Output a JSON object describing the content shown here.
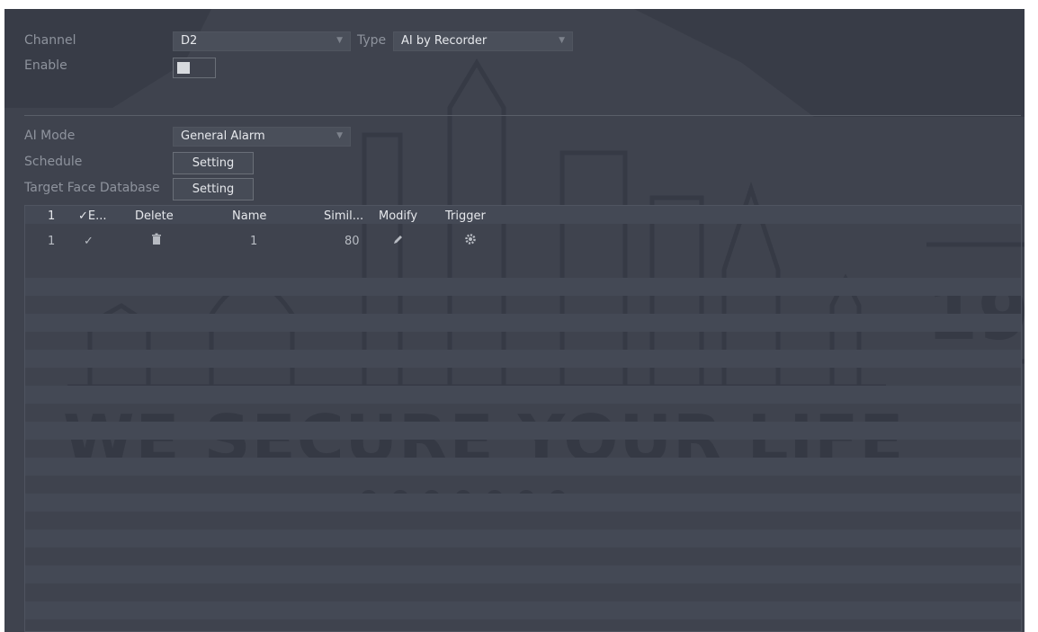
{
  "form": {
    "channel_label": "Channel",
    "channel_value": "D2",
    "type_label": "Type",
    "type_value": "AI by Recorder",
    "enable_label": "Enable",
    "enable_on": true,
    "ai_mode_label": "AI Mode",
    "ai_mode_value": "General Alarm",
    "schedule_label": "Schedule",
    "schedule_button": "Setting",
    "target_face_db_label": "Target Face Database",
    "target_face_db_button": "Setting"
  },
  "table": {
    "headers": [
      "1",
      "✓E...",
      "Delete",
      "Name",
      "Simil...",
      "Modify",
      "Trigger"
    ],
    "rows": [
      {
        "index": "1",
        "enabled": "✓",
        "delete_icon": "trash-icon",
        "name": "1",
        "similarity": "80",
        "modify_icon": "pencil-icon",
        "trigger_icon": "gear-icon"
      }
    ]
  },
  "watermark": {
    "slogan": "WE SECURE YOUR LIFE",
    "number": "19"
  },
  "colors": {
    "panel_bg": "#3f434e",
    "stripe": "#444955",
    "text": "#e6e8ec",
    "label": "#8e939d"
  }
}
